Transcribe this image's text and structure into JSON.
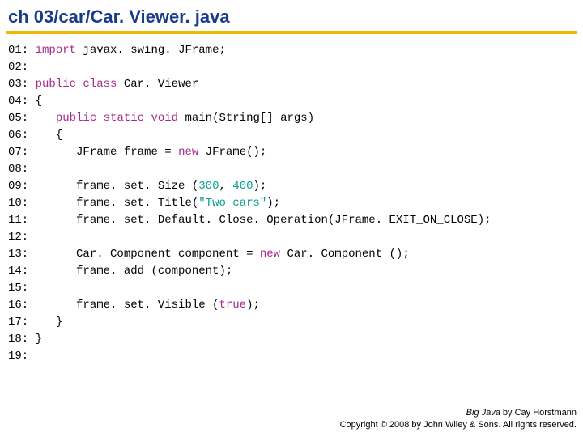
{
  "title": "ch 03/car/Car. Viewer. java",
  "code": {
    "lines": [
      {
        "n": "01:",
        "tokens": [
          {
            "t": " ",
            "c": ""
          },
          {
            "t": "import",
            "c": "kw"
          },
          {
            "t": " javax. swing. JFrame;",
            "c": ""
          }
        ]
      },
      {
        "n": "02:",
        "tokens": []
      },
      {
        "n": "03:",
        "tokens": [
          {
            "t": " ",
            "c": ""
          },
          {
            "t": "public class",
            "c": "kw"
          },
          {
            "t": " Car. Viewer",
            "c": ""
          }
        ]
      },
      {
        "n": "04:",
        "tokens": [
          {
            "t": " {",
            "c": ""
          }
        ]
      },
      {
        "n": "05:",
        "tokens": [
          {
            "t": "    ",
            "c": ""
          },
          {
            "t": "public static void",
            "c": "kw"
          },
          {
            "t": " main(String[] args)",
            "c": ""
          }
        ]
      },
      {
        "n": "06:",
        "tokens": [
          {
            "t": "    {",
            "c": ""
          }
        ]
      },
      {
        "n": "07:",
        "tokens": [
          {
            "t": "       JFrame frame = ",
            "c": ""
          },
          {
            "t": "new",
            "c": "kw"
          },
          {
            "t": " JFrame();",
            "c": ""
          }
        ]
      },
      {
        "n": "08:",
        "tokens": []
      },
      {
        "n": "09:",
        "tokens": [
          {
            "t": "       frame. set. Size (",
            "c": ""
          },
          {
            "t": "300",
            "c": "num"
          },
          {
            "t": ", ",
            "c": ""
          },
          {
            "t": "400",
            "c": "num"
          },
          {
            "t": ");",
            "c": ""
          }
        ]
      },
      {
        "n": "10:",
        "tokens": [
          {
            "t": "       frame. set. Title(",
            "c": ""
          },
          {
            "t": "\"Two cars\"",
            "c": "str"
          },
          {
            "t": ");",
            "c": ""
          }
        ]
      },
      {
        "n": "11:",
        "tokens": [
          {
            "t": "       frame. set. Default. Close. Operation(JFrame. EXIT_ON_CLOSE);",
            "c": ""
          }
        ]
      },
      {
        "n": "12:",
        "tokens": []
      },
      {
        "n": "13:",
        "tokens": [
          {
            "t": "       Car. Component component = ",
            "c": ""
          },
          {
            "t": "new",
            "c": "kw"
          },
          {
            "t": " Car. Component ();",
            "c": ""
          }
        ]
      },
      {
        "n": "14:",
        "tokens": [
          {
            "t": "       frame. add (component);",
            "c": ""
          }
        ]
      },
      {
        "n": "15:",
        "tokens": []
      },
      {
        "n": "16:",
        "tokens": [
          {
            "t": "       frame. set. Visible (",
            "c": ""
          },
          {
            "t": "true",
            "c": "kw"
          },
          {
            "t": ");",
            "c": ""
          }
        ]
      },
      {
        "n": "17:",
        "tokens": [
          {
            "t": "    }",
            "c": ""
          }
        ]
      },
      {
        "n": "18:",
        "tokens": [
          {
            "t": " }",
            "c": ""
          }
        ]
      },
      {
        "n": "19:",
        "tokens": []
      }
    ]
  },
  "footer": {
    "book": "Big Java",
    "author": " by Cay Horstmann",
    "copyright": "Copyright © 2008 by John Wiley & Sons. All rights reserved."
  }
}
